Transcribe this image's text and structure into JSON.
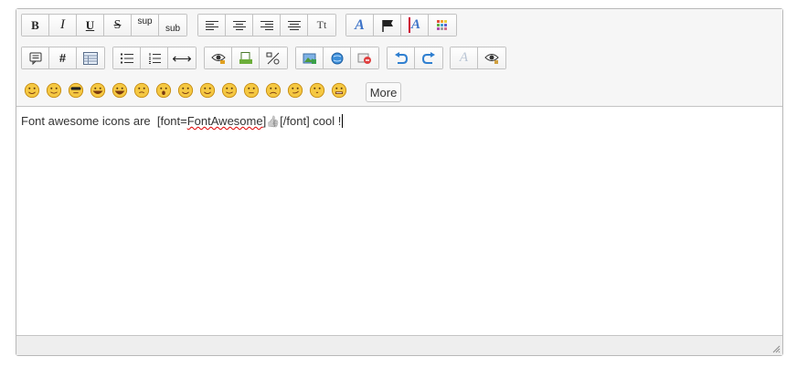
{
  "toolbar": {
    "rows": [
      [
        [
          {
            "name": "bold-button",
            "icon": "bold-icon",
            "text": "B"
          },
          {
            "name": "italic-button",
            "icon": "italic-icon",
            "text": "I"
          },
          {
            "name": "underline-button",
            "icon": "underline-icon",
            "text": "U"
          },
          {
            "name": "strikethrough-button",
            "icon": "strikethrough-icon",
            "text": "S"
          },
          {
            "name": "superscript-button",
            "icon": "superscript-icon",
            "text": "sup"
          },
          {
            "name": "subscript-button",
            "icon": "subscript-icon",
            "text": "sub"
          }
        ],
        [
          {
            "name": "align-left-button",
            "icon": "align-left-icon"
          },
          {
            "name": "align-center-button",
            "icon": "align-center-icon"
          },
          {
            "name": "align-right-button",
            "icon": "align-right-icon"
          },
          {
            "name": "justify-button",
            "icon": "justify-icon"
          },
          {
            "name": "font-button",
            "icon": "font-icon",
            "text": "Tt"
          }
        ],
        [
          {
            "name": "font-style-button",
            "icon": "font-style-icon"
          },
          {
            "name": "flag-button",
            "icon": "flag-icon"
          },
          {
            "name": "font-size-button",
            "icon": "font-size-icon"
          },
          {
            "name": "color-button",
            "icon": "color-grid-icon"
          }
        ]
      ],
      [
        [
          {
            "name": "quote-button",
            "icon": "quote-bubble-icon"
          },
          {
            "name": "hashtag-button",
            "icon": "hashtag-icon",
            "text": "#"
          },
          {
            "name": "table-button",
            "icon": "table-icon"
          }
        ],
        [
          {
            "name": "bullet-list-button",
            "icon": "bullet-list-icon"
          },
          {
            "name": "numbered-list-button",
            "icon": "numbered-list-icon"
          },
          {
            "name": "horizontal-rule-button",
            "icon": "horizontal-rule-icon",
            "text": "⟷"
          }
        ],
        [
          {
            "name": "spoiler-button",
            "icon": "eye-lock-icon"
          },
          {
            "name": "code-button",
            "icon": "code-icon"
          },
          {
            "name": "percent-button",
            "icon": "percent-icon"
          }
        ],
        [
          {
            "name": "insert-image-button",
            "icon": "insert-image-icon"
          },
          {
            "name": "insert-link-button",
            "icon": "link-globe-icon"
          },
          {
            "name": "remove-link-button",
            "icon": "remove-link-icon"
          }
        ],
        [
          {
            "name": "undo-button",
            "icon": "undo-icon"
          },
          {
            "name": "redo-button",
            "icon": "redo-icon"
          }
        ],
        [
          {
            "name": "remove-format-button",
            "icon": "eraser-icon"
          },
          {
            "name": "preview-button",
            "icon": "preview-eye-icon"
          }
        ]
      ]
    ]
  },
  "smileys": [
    "smile",
    "wink",
    "cool",
    "grin",
    "laugh",
    "dizzy",
    "shocked",
    "happy",
    "tongue",
    "blush",
    "neutral",
    "frown",
    "smirk",
    "kiss",
    "grimace"
  ],
  "more_label": "More",
  "content": {
    "text_before": "Font awesome icons are  [font=",
    "misspelled": "FontAwesome",
    "bracket": "]",
    "glyph": "👍",
    "text_after": "[/font] cool !"
  }
}
